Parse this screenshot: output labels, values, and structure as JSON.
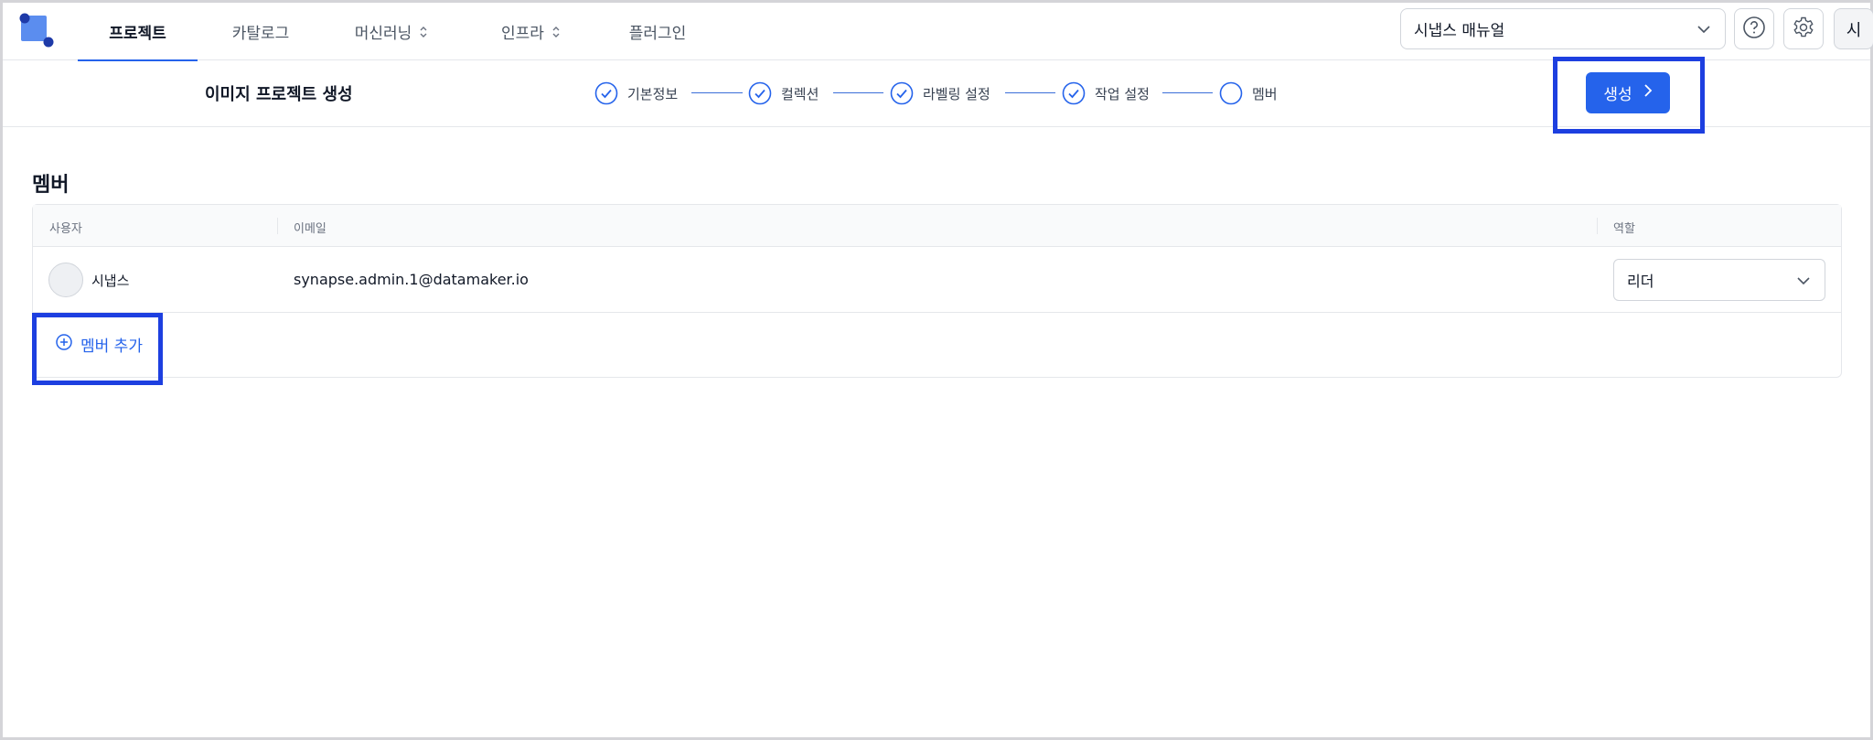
{
  "nav": {
    "items": [
      {
        "label": "프로젝트",
        "active": true
      },
      {
        "label": "카탈로그",
        "active": false
      },
      {
        "label": "머신러닝",
        "active": false,
        "has_chevron": true
      },
      {
        "label": "인프라",
        "active": false,
        "has_chevron": true
      },
      {
        "label": "플러그인",
        "active": false
      }
    ],
    "workspace": "시냅스 매뉴얼",
    "user_initial": "시"
  },
  "header": {
    "title": "이미지 프로젝트 생성",
    "steps": [
      {
        "label": "기본정보",
        "done": true
      },
      {
        "label": "컬렉션",
        "done": true
      },
      {
        "label": "라벨링 설정",
        "done": true
      },
      {
        "label": "작업 설정",
        "done": true
      },
      {
        "label": "멤버",
        "done": false
      }
    ],
    "create_label": "생성"
  },
  "members": {
    "title": "멤버",
    "columns": [
      "사용자",
      "이메일",
      "역할"
    ],
    "rows": [
      {
        "name": "시냅스",
        "email": "synapse.admin.1@datamaker.io",
        "role": "리더"
      }
    ],
    "add_label": "멤버 추가"
  },
  "colors": {
    "accent": "#2563eb",
    "highlight": "#1d3fe0"
  }
}
